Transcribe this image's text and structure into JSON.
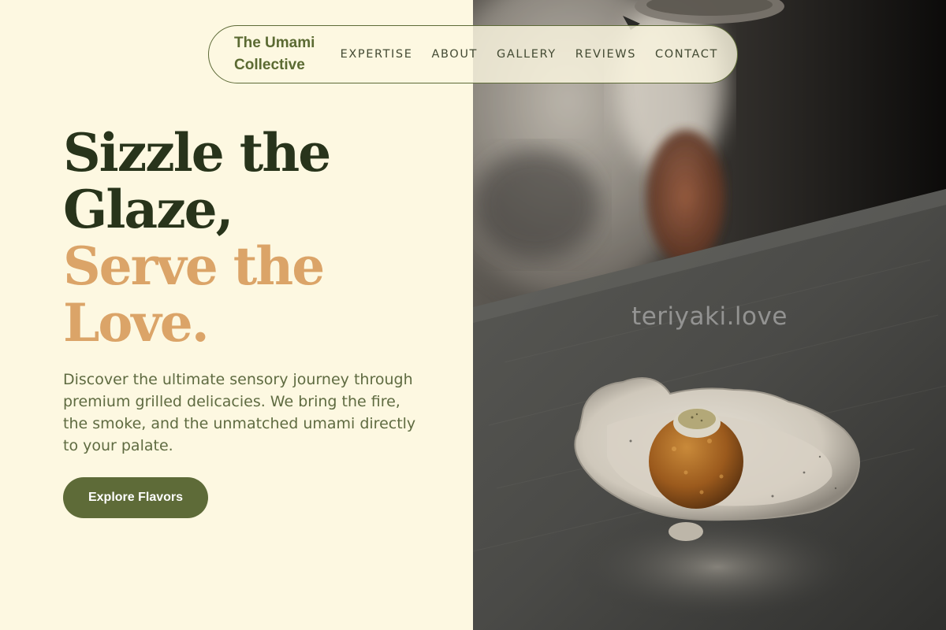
{
  "brand": {
    "line1": "The Umami",
    "line2": "Collective"
  },
  "nav": {
    "links": [
      "EXPERTISE",
      "ABOUT",
      "GALLERY",
      "REVIEWS",
      "CONTACT"
    ]
  },
  "hero": {
    "title_line1": "Sizzle the",
    "title_line2": "Glaze,",
    "title_line3": "Serve the",
    "title_line4": "Love.",
    "description": "Discover the ultimate sensory journey through premium grilled delicacies. We bring the fire, the smoke, and the unmatched umami directly to your palate.",
    "cta_label": "Explore Flavors"
  },
  "photo": {
    "watermark": "teriyaki.love"
  },
  "colors": {
    "background": "#fdf8e1",
    "brand_green": "#5e6b38",
    "title_dark": "#28341b",
    "title_accent": "#dba468",
    "body_text": "#5f6b41"
  }
}
